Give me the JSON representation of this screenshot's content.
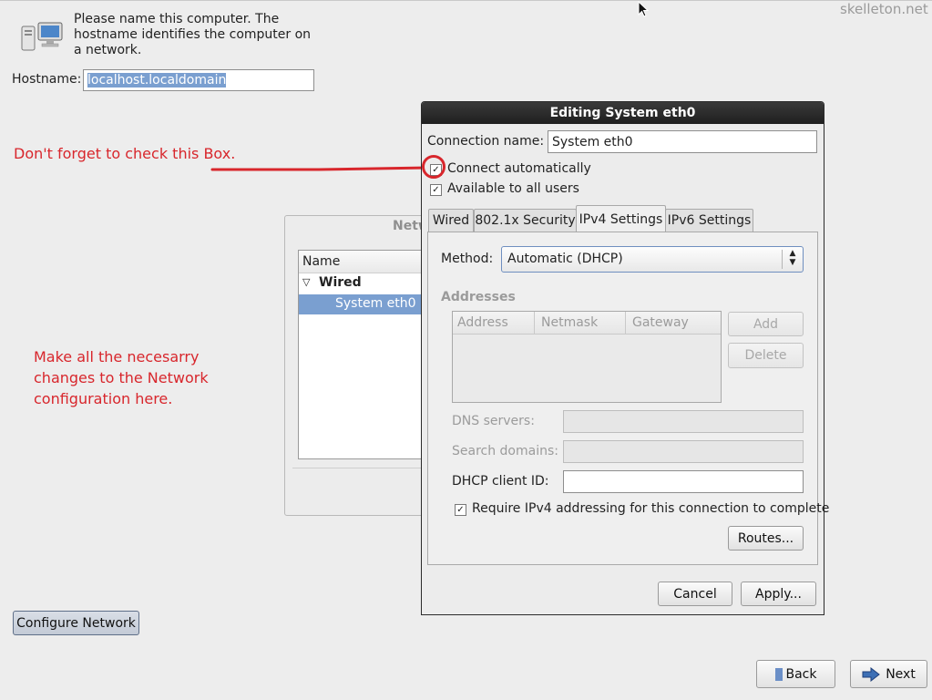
{
  "watermark": "skelleton.net",
  "installer": {
    "intro": "Please name this computer.  The hostname identifies the computer on a network.",
    "hostname_label": "Hostname:",
    "hostname_value": "localhost.localdomain",
    "configure_network_label": "Configure Network",
    "back_label": "Back",
    "next_label": "Next"
  },
  "annotations": {
    "check_box_note": "Don't forget to check this Box.",
    "network_note": "Make all the necesarry changes to the Network configuration here."
  },
  "network_connections": {
    "title_partial": "Netw",
    "column_name": "Name",
    "group": "Wired",
    "item": "System eth0"
  },
  "dialog": {
    "title": "Editing System eth0",
    "connection_name_label": "Connection name:",
    "connection_name_value": "System eth0",
    "connect_automatically": {
      "label": "Connect automatically",
      "checked": true
    },
    "available_to_all_users": {
      "label": "Available to all users",
      "checked": true
    },
    "tabs": [
      "Wired",
      "802.1x Security",
      "IPv4 Settings",
      "IPv6 Settings"
    ],
    "active_tab": "IPv4 Settings",
    "method_label": "Method:",
    "method_value": "Automatic (DHCP)",
    "addresses_heading": "Addresses",
    "address_columns": [
      "Address",
      "Netmask",
      "Gateway"
    ],
    "add_label": "Add",
    "delete_label": "Delete",
    "dns_label": "DNS servers:",
    "search_domains_label": "Search domains:",
    "dhcp_client_id_label": "DHCP client ID:",
    "dhcp_client_id_value": "",
    "require_ipv4": {
      "label": "Require IPv4 addressing for this connection to complete",
      "checked": true
    },
    "routes_label": "Routes...",
    "cancel_label": "Cancel",
    "apply_label": "Apply..."
  },
  "colors": {
    "annotation_red": "#d8262c",
    "selection_blue": "#7a9fd0",
    "dialog_title_bar": "#2b2b2b"
  }
}
